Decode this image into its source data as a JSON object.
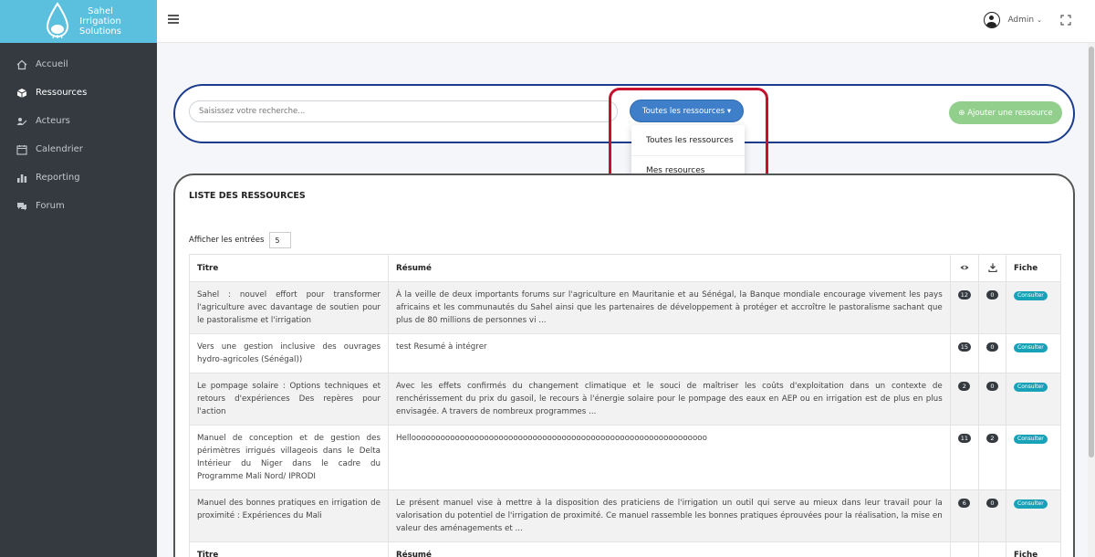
{
  "brand": {
    "line1": "Sahel",
    "line2": "Irrigation",
    "line3": "Solutions"
  },
  "sidebar": {
    "items": [
      {
        "label": "Accueil",
        "icon": "home-icon"
      },
      {
        "label": "Ressources",
        "icon": "cube-icon",
        "active": true
      },
      {
        "label": "Acteurs",
        "icon": "users-icon"
      },
      {
        "label": "Calendrier",
        "icon": "calendar-icon"
      },
      {
        "label": "Reporting",
        "icon": "bar-chart-icon"
      },
      {
        "label": "Forum",
        "icon": "comments-icon"
      }
    ]
  },
  "header": {
    "user_name": "Admin",
    "user_chevron": "⌄"
  },
  "search": {
    "placeholder": "Saisissez votre recherche...",
    "filter_label": "Toutes les ressources ▾",
    "add_label": "⊕ Ajouter une ressource"
  },
  "dropdown": {
    "items": [
      "Toutes les ressources",
      "Mes resources"
    ]
  },
  "list": {
    "title": "LISTE DES RESSOURCES",
    "entries_label": "Afficher les entrées",
    "entries_value": "5",
    "columns": {
      "titre": "Titre",
      "resume": "Résumé",
      "fiche": "Fiche"
    },
    "consult_label": "Consulter",
    "rows": [
      {
        "titre": "Sahel : nouvel effort pour transformer l'agriculture avec davantage de soutien pour le pastoralisme et l'irrigation",
        "resume": "À la veille de deux importants forums sur l'agriculture en Mauritanie et au Sénégal, la Banque mondiale encourage vivement les pays africains et les communautés du Sahel ainsi que les partenaires de développement à protéger et accroître le pastoralisme sachant que plus de 80 millions de personnes vi ...",
        "views": "12",
        "downloads": "0"
      },
      {
        "titre": "Vers une gestion inclusive des ouvrages hydro-agricoles (Sénégal))",
        "resume": "test Resumé à intégrer",
        "views": "15",
        "downloads": "0"
      },
      {
        "titre": "Le pompage solaire : Options techniques et retours d'expériences Des repères pour l'action",
        "resume": "Avec les effets confirmés du changement climatique et le souci de maîtriser les coûts d'exploitation dans un contexte de renchérissement du prix du gasoil, le recours à l'énergie solaire pour le pompage des eaux en AEP ou en irrigation est de plus en plus envisagée. A travers de nombreux programmes ...",
        "views": "2",
        "downloads": "0"
      },
      {
        "titre": "Manuel de conception et de gestion des périmètres irrigués villageois dans le Delta Intérieur du Niger dans le cadre du Programme Mali Nord/ IPRODI",
        "resume": "Hellooooooooooooooooooooooooooooooooooooooooooooooooooooooooooooo",
        "views": "11",
        "downloads": "2"
      },
      {
        "titre": "Manuel des bonnes pratiques en irrigation de proximité : Expériences du Mali",
        "resume": "Le présent manuel vise à mettre à la disposition des praticiens de l'irrigation un outil qui serve au mieux dans leur travail pour la valorisation du potentiel de l'irrigation de proximité. Ce manuel rassemble les bonnes pratiques éprouvées pour la réalisation, la mise en valeur des aménagements et ...",
        "views": "6",
        "downloads": "0"
      }
    ]
  }
}
